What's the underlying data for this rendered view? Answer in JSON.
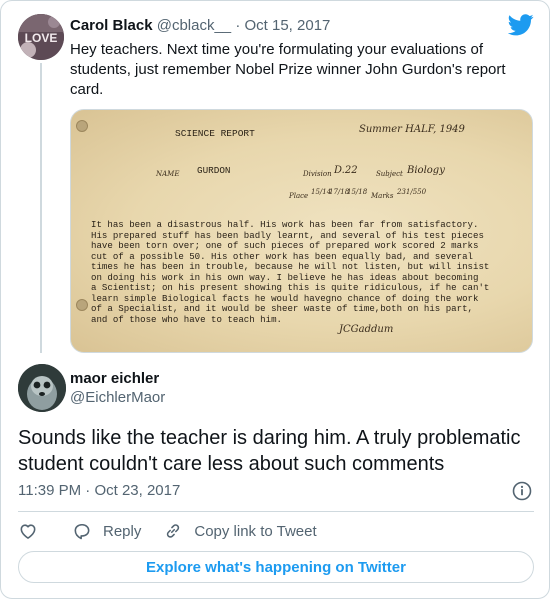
{
  "quoted_tweet": {
    "author_name": "Carol Black",
    "author_handle": "@cblack__",
    "separator": "·",
    "date": "Oct 15, 2017",
    "text": "Hey teachers. Next time you're formulating your evaluations of students, just remember Nobel Prize winner John Gurdon's report card.",
    "avatar_text": "LOVE"
  },
  "report_card": {
    "heading": "SCIENCE REPORT",
    "term": "Summer HALF, 1949",
    "name_label": "NAME",
    "name_value": "GURDON",
    "division_label": "Division",
    "division_value": "D.22",
    "subject_label": "Subject",
    "subject_value": "Biology",
    "place_label": "Place",
    "place_values": [
      "15/14",
      "17/18",
      "15/18"
    ],
    "marks_label": "Marks",
    "marks_value": "231/550",
    "comment_lines": [
      "It has been a disastrous half.   His work has been far from satisfactory.",
      "His prepared stuff has been badly learnt, and several of his test pieces",
      "have been torn over;  one of such pieces of prepared work scored 2 marks",
      "cut of a possible 50.  His other work has been equally bad, and several",
      "times he has been in trouble, because he will not listen, but will insist",
      "on doing his work in his own way.  I believe he has ideas about becoming",
      "a Scientist; on his present showing this is quite ridiculous, if he can't",
      "learn simple Biological facts he would havegno chance of doing the work",
      "of a Specialist, and it would be sheer waste of time,both on his part,",
      "and of those who have to teach him."
    ],
    "signature": "JCGaddum"
  },
  "main_tweet": {
    "author_name": "maor eichler",
    "author_handle": "@EichlerMaor",
    "text": "Sounds like the teacher is daring him. A truly problematic student couldn't care less about such comments",
    "time": "11:39 PM",
    "separator": "·",
    "date": "Oct 23, 2017"
  },
  "actions": {
    "like_icon": "heart-icon",
    "reply_label": "Reply",
    "copy_link_label": "Copy link to Tweet"
  },
  "explore_label": "Explore what's happening on Twitter",
  "colors": {
    "brand_blue": "#1d9bf0",
    "text_primary": "#0f1419",
    "text_secondary": "#536471",
    "border": "#cfd9de"
  }
}
